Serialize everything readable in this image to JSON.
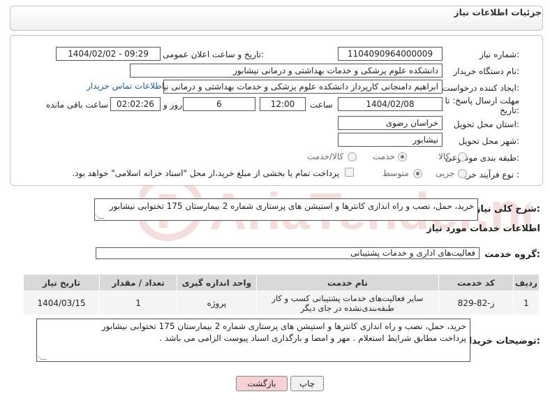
{
  "header": {
    "title": "جزئیات اطلاعات نیاز"
  },
  "form": {
    "need_number_label": "شماره نیاز:",
    "need_number": "1104090964000009",
    "announce_label": "تاریخ و ساعت اعلان عمومی:",
    "announce_value": "1404/02/02 - 09:29",
    "buyer_org_label": "نام دستگاه خریدار:",
    "buyer_org": "دانشکده علوم پزشکی و خدمات بهداشتی و درمانی نیشابور",
    "creator_label": "ایجاد کننده درخواست:",
    "creator": "ابراهیم دامنجانی  کارپرداز دانشکده علوم پزشکی و خدمات بهداشتی و درمانی نیشابور",
    "contact_link": "اطلاعات تماس خریدار",
    "deadline_label_line1": "مهلت ارسال پاسخ: تا",
    "deadline_label_line2": "تاریخ:",
    "deadline_date": "1404/02/08",
    "time_label": "ساعت",
    "deadline_time": "12:00",
    "days_value": "6",
    "days_label": "روز و",
    "remaining_time": "02:02:26",
    "remaining_label": "ساعت باقی مانده",
    "province_label": "استان محل تحویل:",
    "province": "خراسان رضوی",
    "city_label": "شهر محل تحویل:",
    "city": "نیشابور",
    "category_label": "طبقه بندی موضوعی:",
    "category_options": [
      "کالا",
      "خدمت",
      "کالا/خدمت"
    ],
    "category_selected": 1,
    "process_label": "نوع فرآیند خرید :",
    "process_options": [
      "جزیی",
      "متوسط"
    ],
    "process_selected": 1,
    "payment_note": "پرداخت تمام یا بخشی از مبلغ خرید،از محل \"اسناد خزانه اسلامی\" خواهد بود."
  },
  "summary": {
    "label": "شرح کلی نیاز:",
    "text": "خرید، حمل، نصب و راه اندازی کانترها و استیشن های پرستاری شماره 2 بیمارستان 175 تختوابی نیشابور"
  },
  "services": {
    "title": "اطلاعات خدمات مورد نیاز",
    "group_label": "گروه خدمت:",
    "group_value": "فعالیت‌های اداری و خدمات پشتیبانی",
    "columns": [
      "ردیف",
      "کد خدمت",
      "نام خدمت",
      "واحد اندازه گیری",
      "تعداد / مقدار",
      "تاریخ نیاز"
    ],
    "rows": [
      {
        "index": "1",
        "code": "ز-82-829",
        "name": "سایر فعالیت‌های خدمات پشتیبانی کسب و کار طبقه‌بندی‌نشده در جای دیگر",
        "unit": "پروژه",
        "quantity": "1",
        "date": "1404/03/15"
      }
    ]
  },
  "buyer_notes": {
    "label": "توضیحات خریدار:",
    "line1": "خرید، حمل، نصب و راه اندازی کانترها و استیشن های پرستاری شماره 2 بیمارستان 175 تختوابی نیشابور",
    "line2": "پرداخت  مطابق شرایط استعلام . مهر و امضا و بارگذاری اسناد پیوست الزامی می باشد ."
  },
  "buttons": {
    "print": "چاپ",
    "back": "بازگشت"
  },
  "watermark": {
    "text": "AriaTender.neT"
  },
  "colors": {
    "link": "#1a5fa8",
    "back_button": "#f6d2d2",
    "print_button": "#f2f2f2",
    "watermark": "#c0392b"
  }
}
